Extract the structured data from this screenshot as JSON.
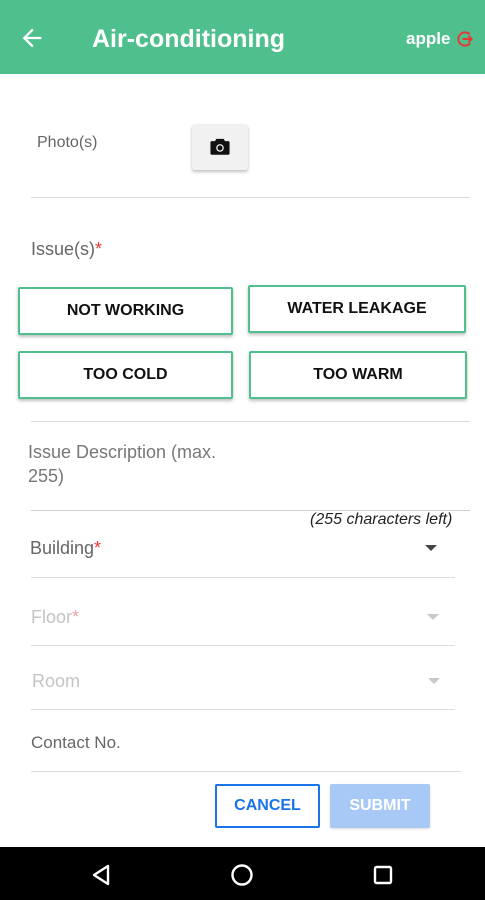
{
  "appbar": {
    "title": "Air-conditioning",
    "username": "apple",
    "back_icon": "arrow-left-icon",
    "logout_icon": "logout-icon",
    "color": "#4fc08d"
  },
  "form": {
    "photo_label": "Photo(s)",
    "camera_icon": "camera-icon",
    "issues_label": "Issue(s)",
    "required_mark": "*",
    "issues": [
      "NOT WORKING",
      "WATER LEAKAGE",
      "TOO COLD",
      "TOO WARM"
    ],
    "description_placeholder": "Issue Description (max. 255)",
    "chars_left": "(255 characters left)",
    "building_label": "Building",
    "floor_label": "Floor",
    "room_label": "Room",
    "contact_placeholder": "Contact No."
  },
  "actions": {
    "cancel": "CANCEL",
    "submit": "SUBMIT"
  },
  "navbar": {
    "back_icon": "nav-back-icon",
    "home_icon": "nav-home-icon",
    "recents_icon": "nav-recents-icon"
  }
}
